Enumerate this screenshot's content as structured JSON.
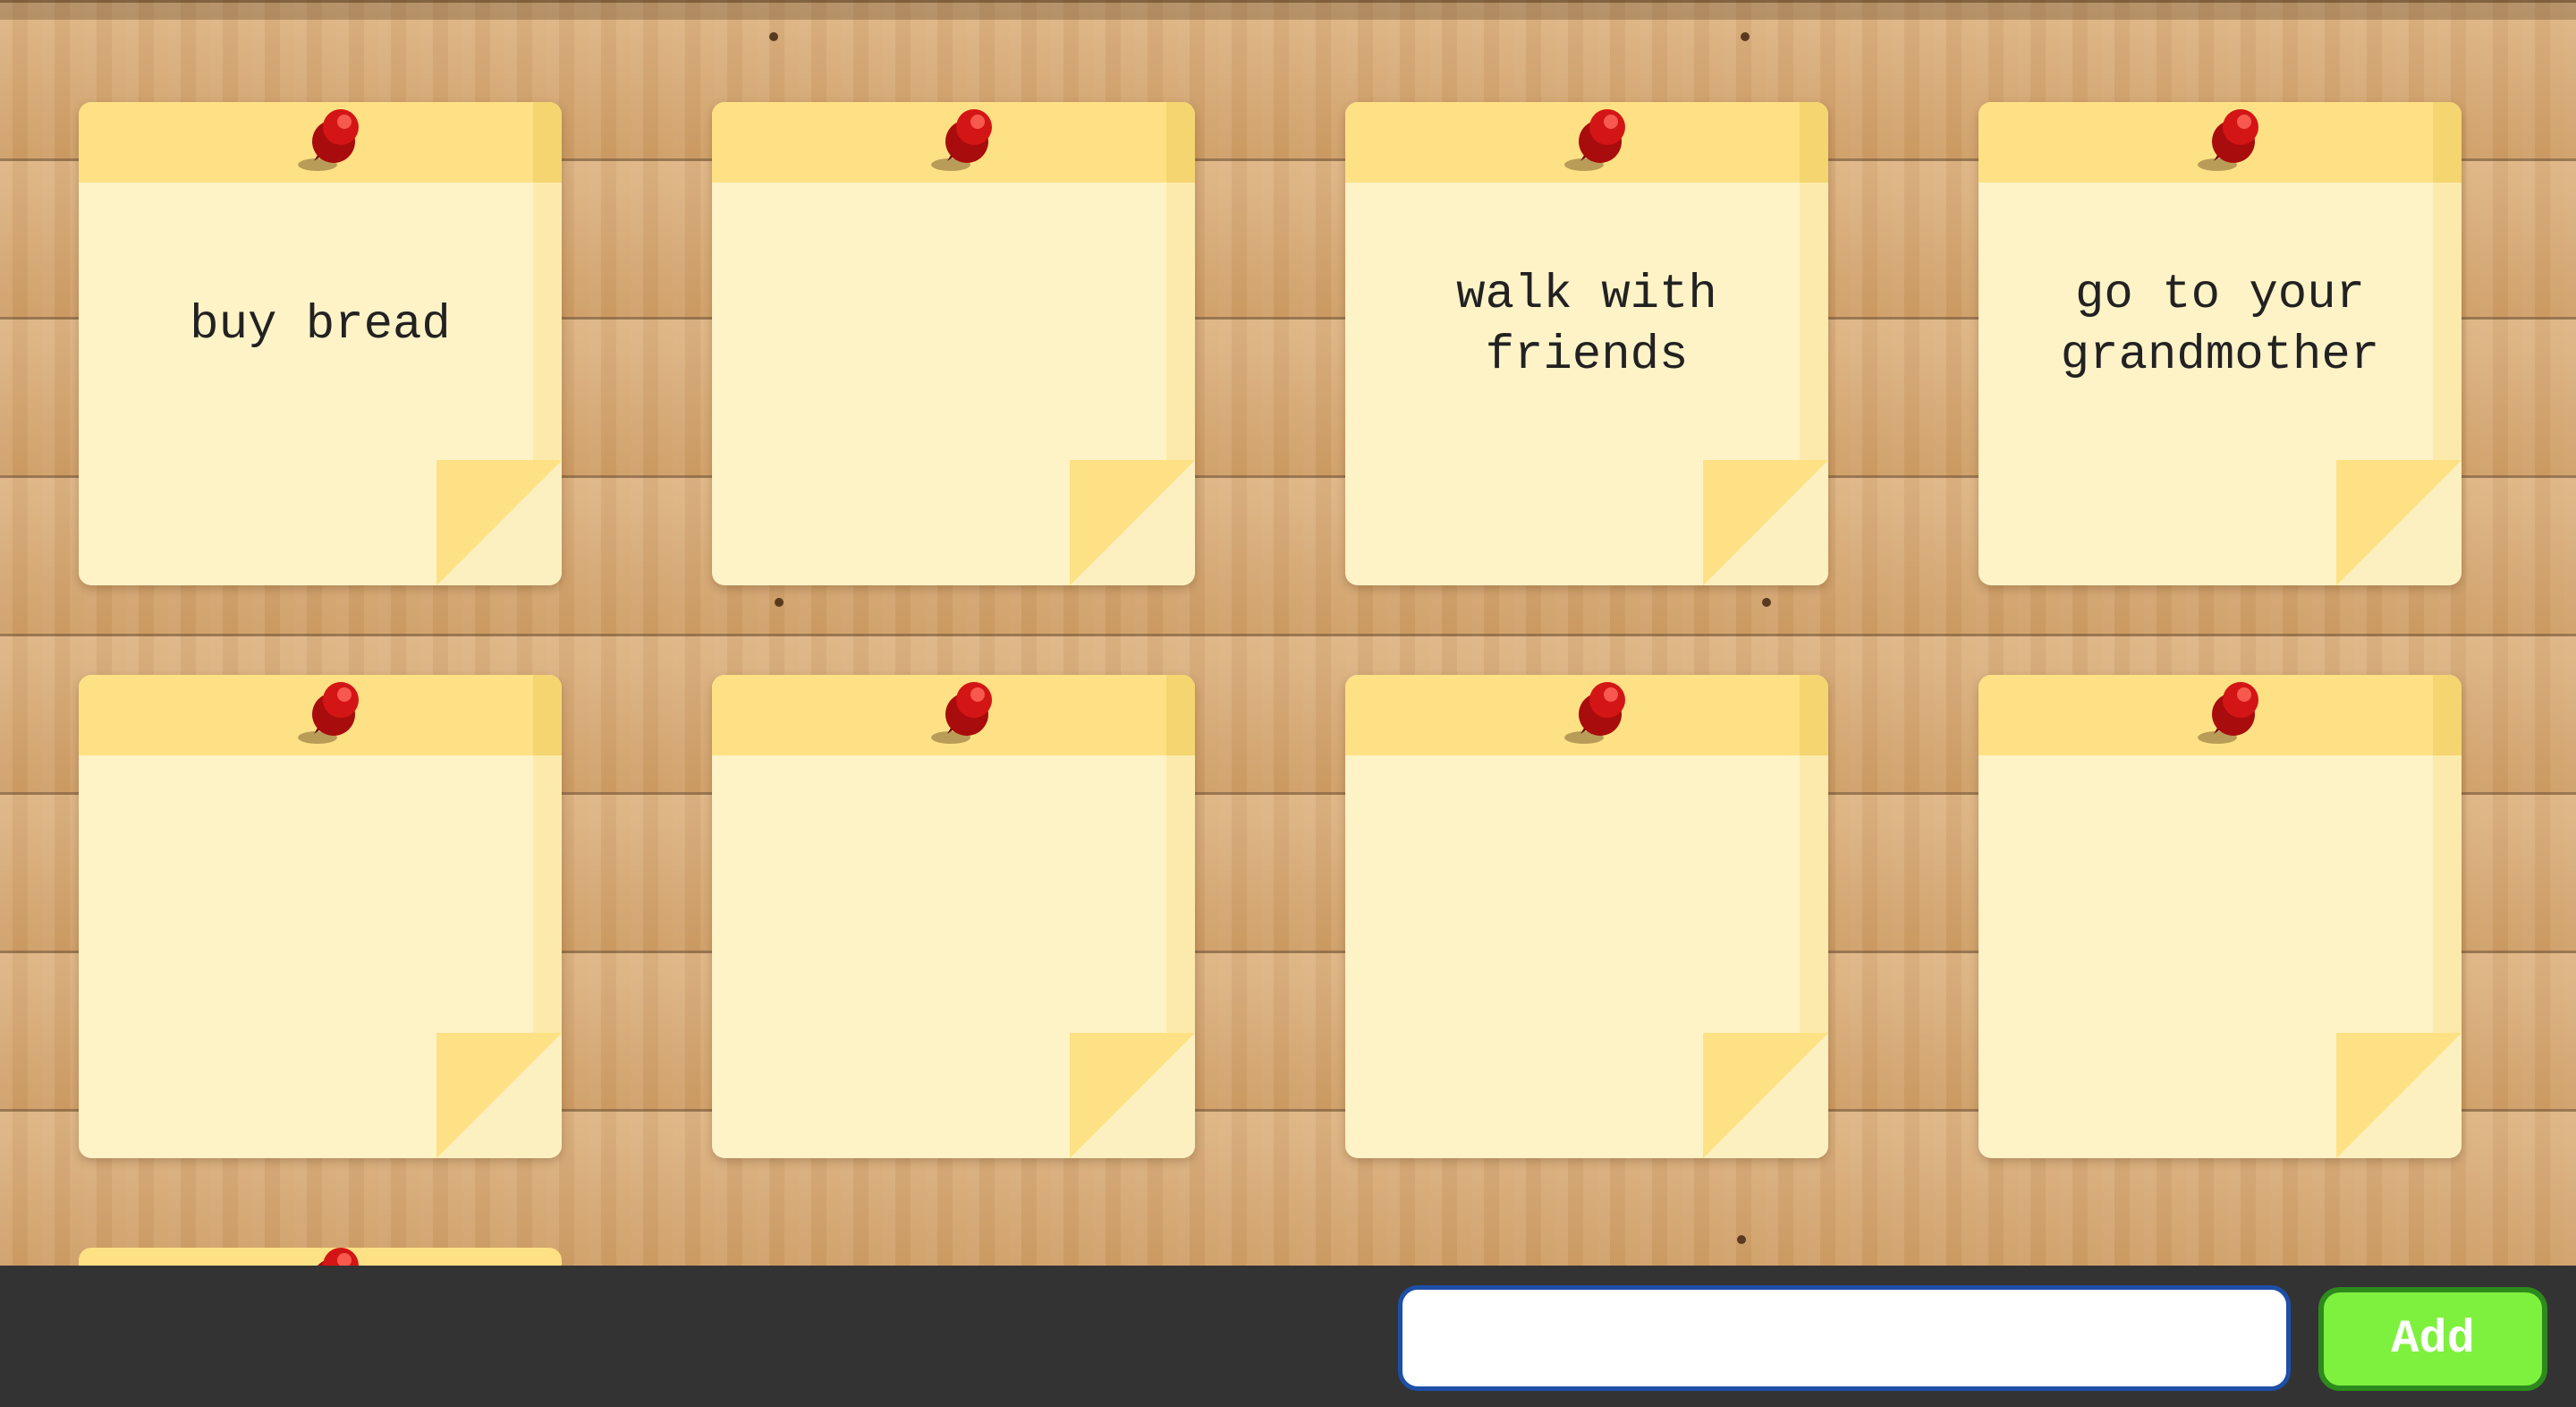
{
  "colors": {
    "board_wood": "#d7ab77",
    "note_body": "#fef3c7",
    "note_band": "#fde184",
    "pin_red": "#c01010",
    "toolbar_bg": "#333333",
    "add_button_bg": "#7ef13e",
    "add_button_border": "#2d8a1c",
    "input_border": "#1e4fa8"
  },
  "icons": {
    "pin": "push-pin-icon"
  },
  "notes": [
    {
      "text": "buy bread"
    },
    {
      "text": ""
    },
    {
      "text": "walk with friends"
    },
    {
      "text": "go to your grandmother"
    },
    {
      "text": ""
    },
    {
      "text": ""
    },
    {
      "text": ""
    },
    {
      "text": ""
    },
    {
      "text": ""
    }
  ],
  "toolbar": {
    "input_value": "",
    "input_placeholder": "",
    "add_label": "Add"
  }
}
